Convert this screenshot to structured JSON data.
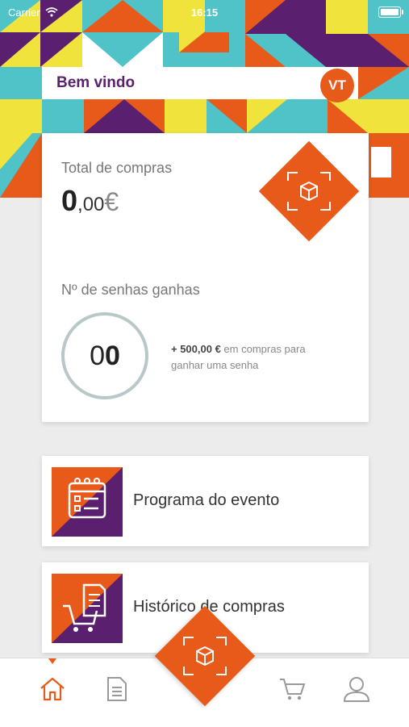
{
  "status_bar": {
    "carrier": "Carrier",
    "time": "16:15"
  },
  "header": {
    "welcome": "Bem vindo",
    "avatar_initials": "VT"
  },
  "summary": {
    "total_label": "Total de compras",
    "total_integer": "0",
    "total_decimal": ",00",
    "total_currency": "€",
    "senhas_label": "Nº de senhas ganhas",
    "senhas_value_light": "0",
    "senhas_value_bold": "0",
    "hint_bold": "+ 500,00 €",
    "hint_rest": " em compras para ganhar uma senha"
  },
  "menu": {
    "items": [
      {
        "label": "Programa do evento",
        "icon": "calendar-icon"
      },
      {
        "label": "Histórico de compras",
        "icon": "cart-receipt-icon"
      }
    ]
  },
  "nav": {
    "items": [
      {
        "name": "home",
        "icon": "home-icon",
        "active": true
      },
      {
        "name": "documents",
        "icon": "document-icon"
      },
      {
        "name": "scan",
        "icon": "scan-icon"
      },
      {
        "name": "cart",
        "icon": "cart-icon"
      },
      {
        "name": "profile",
        "icon": "user-icon"
      }
    ]
  },
  "colors": {
    "accent": "#e85a1a",
    "purple": "#5a1f6e",
    "teal": "#4fc3c7",
    "yellow": "#f0e33c"
  }
}
